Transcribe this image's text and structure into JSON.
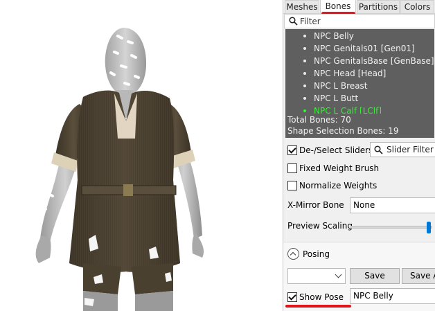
{
  "tabs": [
    {
      "label": "Meshes"
    },
    {
      "label": "Bones"
    },
    {
      "label": "Partitions"
    },
    {
      "label": "Colors"
    }
  ],
  "active_tab": "Bones",
  "filter": {
    "placeholder": "Filter",
    "icon": "search-icon"
  },
  "bones": [
    {
      "label": "NPC Belly"
    },
    {
      "label": "NPC Genitals01 [Gen01]"
    },
    {
      "label": "NPC GenitalsBase [GenBase]"
    },
    {
      "label": "NPC Head [Head]"
    },
    {
      "label": "NPC L Breast"
    },
    {
      "label": "NPC L Butt"
    },
    {
      "label": "NPC L Calf [LClf]"
    }
  ],
  "highlight_color": "#2df52d",
  "accent_color": "#e0161d",
  "stats": {
    "total": "Total Bones: 70",
    "shape_selection": "Shape Selection Bones: 19"
  },
  "controls": {
    "deselect_sliders": {
      "label": "De-/Select Sliders",
      "checked": true
    },
    "slider_filter_placeholder": "Slider Filter",
    "fixed_weight_brush": {
      "label": "Fixed Weight Brush",
      "checked": false
    },
    "normalize_weights": {
      "label": "Normalize Weights",
      "checked": false
    },
    "x_mirror_bone": {
      "label": "X-Mirror Bone",
      "value": "None"
    },
    "preview_scaling": {
      "label": "Preview Scaling",
      "value_fraction": 0.96
    }
  },
  "posing": {
    "label": "Posing",
    "pose_select_value": "",
    "save_label": "Save",
    "save_as_label": "Save As",
    "show_pose": {
      "label": "Show Pose",
      "checked": true
    },
    "bone_select_value": "NPC Belly"
  }
}
